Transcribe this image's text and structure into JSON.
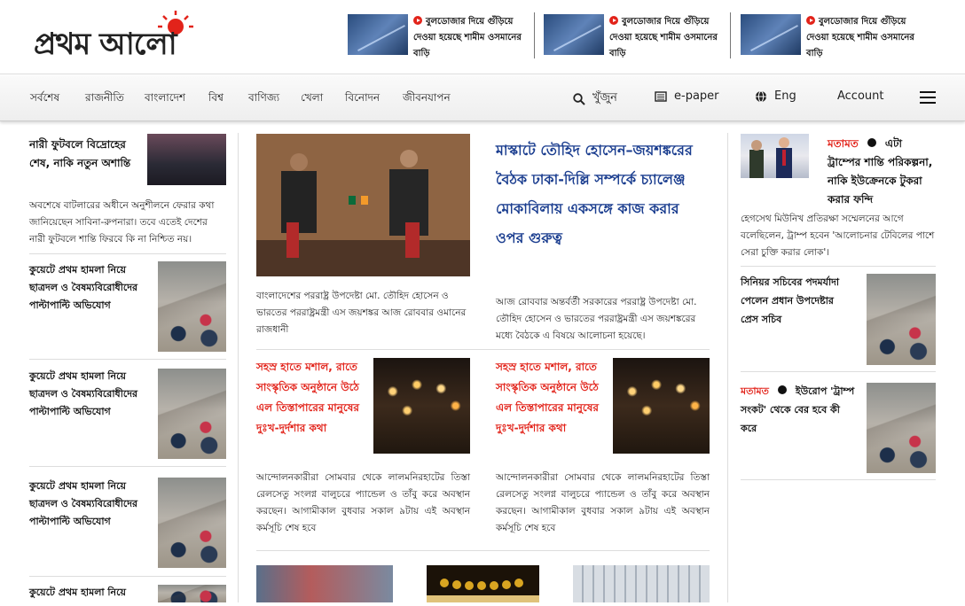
{
  "logo": {
    "text": "প্রথম আলো",
    "sun_color": "#e2231a"
  },
  "teasers": [
    {
      "text": "বুলডোজার দিয়ে গুঁড়িয়ে দেওয়া হয়েছে শামীম ওসমানের বাড়ি"
    },
    {
      "text": "বুলডোজার দিয়ে গুঁড়িয়ে দেওয়া হয়েছে শামীম ওসমানের বাড়ি"
    },
    {
      "text": "বুলডোজার দিয়ে গুঁড়িয়ে দেওয়া হয়েছে শামীম ওসমানের বাড়ি"
    }
  ],
  "nav": {
    "items": [
      "সর্বশেষ",
      "রাজনীতি",
      "বাংলাদেশ",
      "বিশ্ব",
      "বাণিজ্য",
      "খেলা",
      "বিনোদন",
      "জীবনযাপন"
    ],
    "search": "খুঁজুন",
    "epaper": "e-paper",
    "lang": "Eng",
    "account": "Account"
  },
  "left": {
    "lead": {
      "title": "নারী ফুটবলে বিদ্রোহের শেষ, নাকি নতুন অশান্তি",
      "summary": "অবশেষে বাটলারের অধীনে অনুশীলনে ফেরার কথা জানিয়েছেন সাবিনা-রুপনারা। তবে এতেই দেশের নারী ফুটবলে শান্তি ফিরবে কি না নিশ্চিত নয়।"
    },
    "items": [
      {
        "title": "কুয়েটে প্রথম হামলা নিয়ে ছাত্রদল ও বৈষম্যবিরোধীদের পাল্টাপাল্টি অভিযোগ"
      },
      {
        "title": "কুয়েটে প্রথম হামলা নিয়ে ছাত্রদল ও বৈষম্যবিরোধীদের পাল্টাপাল্টি অভিযোগ"
      },
      {
        "title": "কুয়েটে প্রথম হামলা নিয়ে ছাত্রদল ও বৈষম্যবিরোধীদের পাল্টাপাল্টি অভিযোগ"
      },
      {
        "title": "কুয়েটে প্রথম হামলা নিয়ে"
      }
    ]
  },
  "main": {
    "headline": "মাস্কাটে তৌহিদ হোসেন–জয়শঙ্করের বৈঠক ঢাকা-দিল্লি সম্পর্কে চ্যালেঞ্জ মোকাবিলায় একসঙ্গে কাজ করার ওপর গুরুত্ব",
    "caption": "বাংলাদেশের পররাষ্ট্র উপদেষ্টা মো. তৌহিদ হোসেন ও ভারতের পররাষ্ট্রমন্ত্রী এস জয়শঙ্কর আজ রোববার ওমানের রাজধানী",
    "summary": "আজ রোববার অন্তর্বর্তী সরকারের পররাষ্ট্র উপদেষ্টা মো. তৌহিদ হোসেন ও ভারতের পররাষ্ট্রমন্ত্রী এস জয়শঙ্করের মধ্যে বৈঠকে এ বিষয়ে আলোচনা হয়েছে।",
    "stories": [
      {
        "title": "সহস্র হাতে মশাল, রাতে সাংস্কৃতিক অনুষ্ঠানে উঠে এল তিস্তাপারের মানুষের দুঃখ-দুর্দশার কথা",
        "summary": "আন্দোলনকারীরা সোমবার থেকে লালমনিরহাটের তিস্তা রেলসেতু সংলগ্ন বালুচরে প্যান্ডেল ও তাঁবু করে অবস্থান করছেন। আগামীকাল বুধবার সকাল ৯টায় এই অবস্থান কর্মসূচি শেষ হবে"
      },
      {
        "title": "সহস্র হাতে মশাল, রাতে সাংস্কৃতিক অনুষ্ঠানে উঠে এল তিস্তাপারের মানুষের দুঃখ-দুর্দশার কথা",
        "summary": "আন্দোলনকারীরা সোমবার থেকে লালমনিরহাটের তিস্তা রেলসেতু সংলগ্ন বালুচরে প্যান্ডেল ও তাঁবু করে অবস্থান করছেন। আগামীকাল বুধবার সকাল ৯টায় এই অবস্থান কর্মসূচি শেষ হবে"
      }
    ]
  },
  "right": {
    "opinion1": {
      "label": "মতামত",
      "title": "এটা ট্রাম্পের শান্তি পরিকল্পনা, নাকি ইউক্রেনকে টুকরা করার ফন্দি",
      "summary": "হেগসেথ মিউনিখ প্রতিরক্ষা সম্মেলনের আগে বলেছিলেন, ট্রাম্প হবেন 'আলোচনার টেবিলের পাশে সেরা চুক্তি করার লোক'।"
    },
    "story": {
      "title": "সিনিয়র সচিবের পদমর্যাদা পেলেন প্রধান উপদেষ্টার প্রেস সচিব"
    },
    "opinion2": {
      "label": "মতামত",
      "title": "ইউরোপ 'ট্রাম্প সংকট' থেকে বের হবে কী করে"
    }
  }
}
